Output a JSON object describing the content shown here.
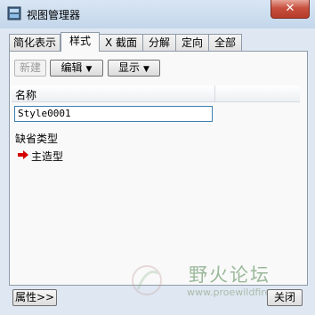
{
  "window": {
    "title": "视图管理器",
    "close_label": "✕"
  },
  "tabs": [
    {
      "label": "简化表示",
      "active": false
    },
    {
      "label": "样式",
      "active": true
    },
    {
      "label": "X 截面",
      "active": false
    },
    {
      "label": "分解",
      "active": false
    },
    {
      "label": "定向",
      "active": false
    },
    {
      "label": "全部",
      "active": false
    }
  ],
  "toolbar": {
    "new_label": "新建",
    "edit_label": "编辑",
    "display_label": "显示"
  },
  "list": {
    "column_header": "名称",
    "editing_value": "Style0001",
    "default_label": "缺省类型",
    "main_style_label": "主造型"
  },
  "footer": {
    "properties_label": "属性>>",
    "close_button_label": "关闭"
  },
  "watermark": {
    "text": "野火论坛",
    "url": "www.proewildfire"
  },
  "colors": {
    "arrow": "#d40000",
    "titlebar": "#c3d6ea",
    "close": "#c7503e"
  }
}
